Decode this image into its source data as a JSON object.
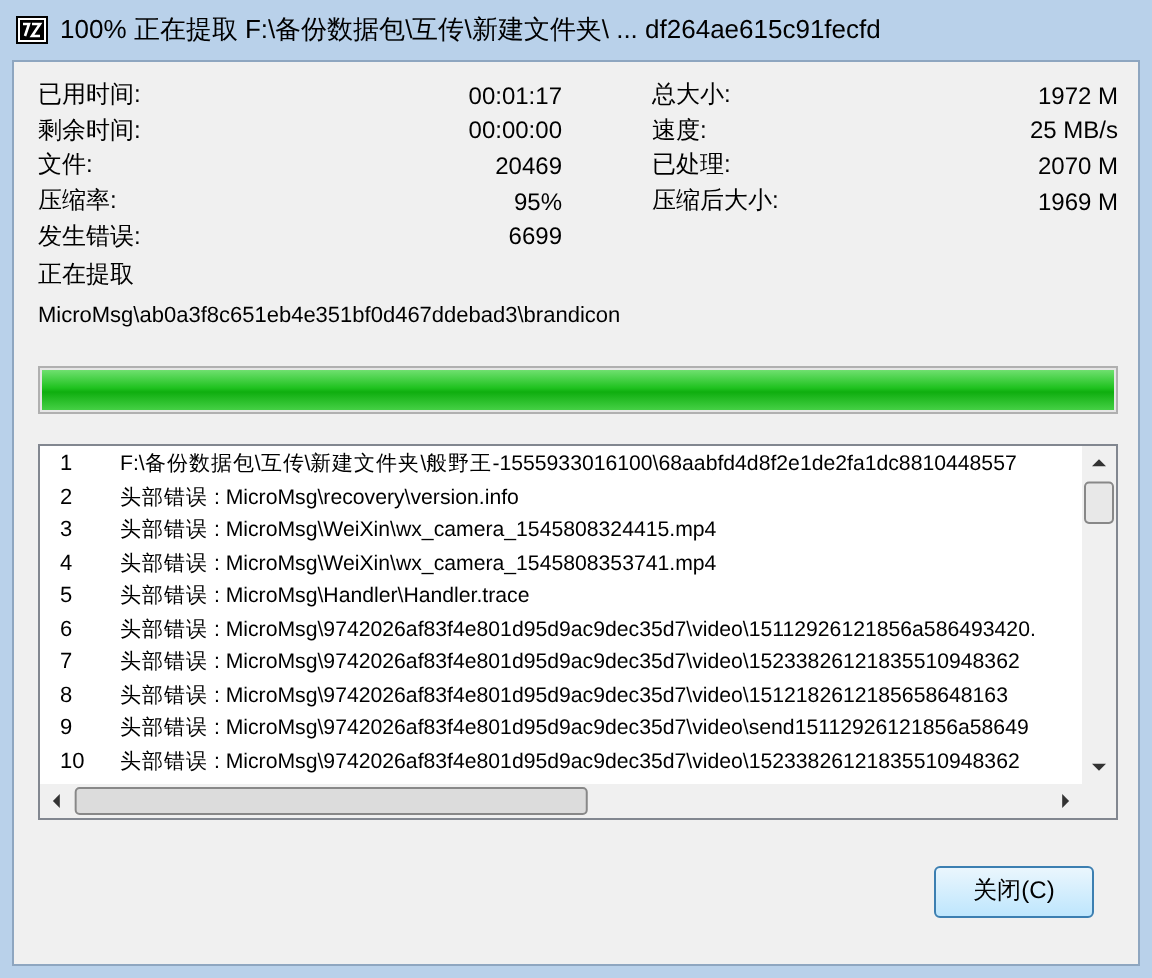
{
  "window": {
    "title": "100% 正在提取 F:\\备份数据包\\互传\\新建文件夹\\ ... df264ae615c91fecfd"
  },
  "stats_left": [
    {
      "label": "已用时间:",
      "value": "00:01:17"
    },
    {
      "label": "剩余时间:",
      "value": "00:00:00"
    },
    {
      "label": "文件:",
      "value": "20469"
    },
    {
      "label": "压缩率:",
      "value": "95%"
    },
    {
      "label": "发生错误:",
      "value": "6699"
    }
  ],
  "stats_right": [
    {
      "label": "总大小:",
      "value": "1972 M"
    },
    {
      "label": "速度:",
      "value": "25 MB/s"
    },
    {
      "label": "已处理:",
      "value": "2070 M"
    },
    {
      "label": "压缩后大小:",
      "value": "1969 M"
    }
  ],
  "current": {
    "label": "正在提取",
    "path": "MicroMsg\\ab0a3f8c651eb4e351bf0d467ddebad3\\brandicon"
  },
  "progress": {
    "level": 1
  },
  "log": [
    {
      "number": "1",
      "text": "F:\\备份数据包\\互传\\新建文件夹\\般野王-1555933016100\\68aabfd4d8f2e1de2fa1dc8810448557"
    },
    {
      "number": "2",
      "text": "头部错误 : MicroMsg\\recovery\\version.info"
    },
    {
      "number": "3",
      "text": "头部错误 : MicroMsg\\WeiXin\\wx_camera_1545808324415.mp4"
    },
    {
      "number": "4",
      "text": "头部错误 : MicroMsg\\WeiXin\\wx_camera_1545808353741.mp4"
    },
    {
      "number": "5",
      "text": "头部错误 : MicroMsg\\Handler\\Handler.trace"
    },
    {
      "number": "6",
      "text": "头部错误 : MicroMsg\\9742026af83f4e801d95d9ac9dec35d7\\video\\15112926121856a586493420."
    },
    {
      "number": "7",
      "text": "头部错误 : MicroMsg\\9742026af83f4e801d95d9ac9dec35d7\\video\\15233826121835510948362"
    },
    {
      "number": "8",
      "text": "头部错误 : MicroMsg\\9742026af83f4e801d95d9ac9dec35d7\\video\\1512182612185658648163"
    },
    {
      "number": "9",
      "text": "头部错误 : MicroMsg\\9742026af83f4e801d95d9ac9dec35d7\\video\\send15112926121856a58649"
    },
    {
      "number": "10",
      "text": "头部错误 : MicroMsg\\9742026af83f4e801d95d9ac9dec35d7\\video\\15233826121835510948362"
    }
  ],
  "buttons": [
    {
      "label": "关闭(C)"
    }
  ]
}
